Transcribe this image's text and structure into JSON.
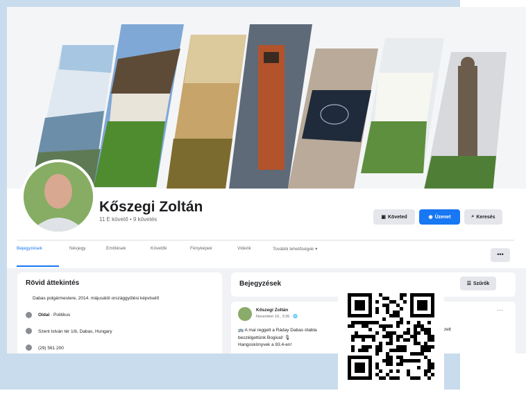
{
  "profile": {
    "name": "Kőszegi Zoltán",
    "followers": "11 E követő • 9 követés"
  },
  "actions": {
    "follow": "Követed",
    "message": "Üzenet",
    "search": "Keresés"
  },
  "tabs": [
    "Bejegyzések",
    "Névjegy",
    "Említések",
    "Követők",
    "Fényképek",
    "Videók",
    "További lehetőségek ▾"
  ],
  "more_button": "•••",
  "intro": {
    "title": "Rövid áttekintés",
    "bio": "Dabas polgármestere, 2014. májusától országgyűlési képviselő",
    "category_label": "Oldal",
    "category_value": "· Politikus",
    "address": "Szent István tér 1/b, Dabas, Hungary",
    "phone": "(29) 561 200"
  },
  "posts": {
    "title": "Bejegyzések",
    "filter_label": "Szűrők",
    "author": "Kőszegi Zoltán",
    "date": "November 10., 3:36 · 🌐",
    "line1": "🚌 A mai reggelt a Ráday Dabas ótabla",
    "line1_cont": "kezelt",
    "line2": "beszélgettünk Bogival! 🎙",
    "line3": "Hangoskönyvek a 93.4-en!"
  },
  "colors": {
    "accent": "#1877f2",
    "background": "#c9dced"
  }
}
